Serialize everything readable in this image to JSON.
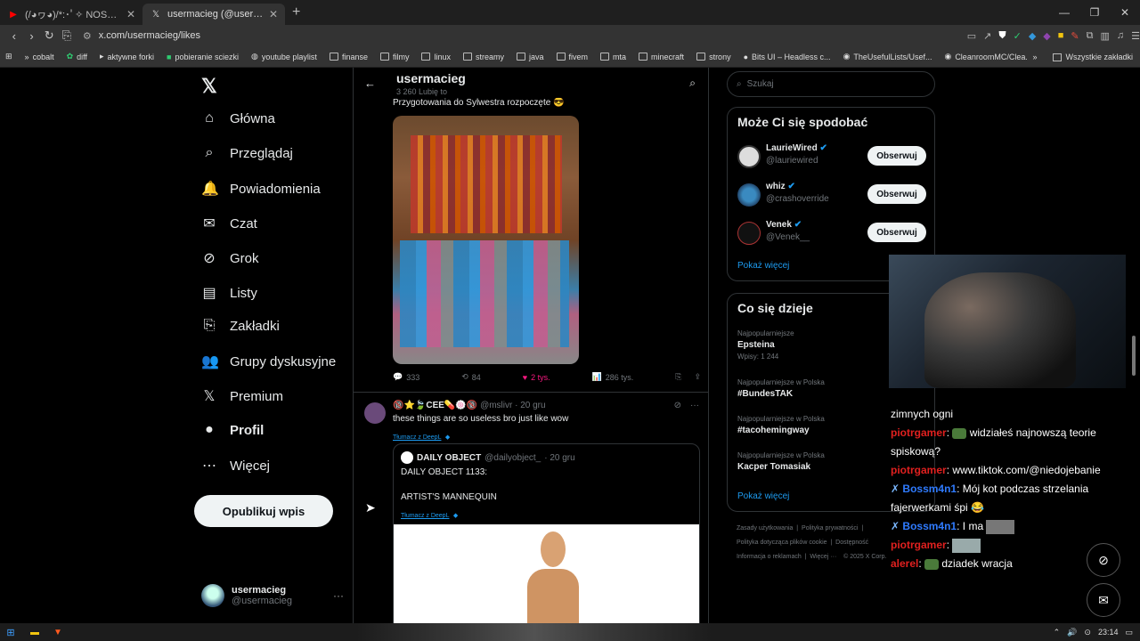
{
  "browser": {
    "tabs": [
      {
        "title": "(/◕ヮ◕)/*:･ﾟ✧ NOSTALGIC HEXD",
        "active": false
      },
      {
        "title": "usermacieg (@usermacieg) / X",
        "active": true
      }
    ],
    "new_tab": "+",
    "url": "x.com/usermacieg/likes",
    "bookmarks": [
      "cobalt",
      "diff",
      "aktywne forki",
      "pobieranie sciezki",
      "youtube playlist",
      "finanse",
      "filmy",
      "linux",
      "streamy",
      "java",
      "fivem",
      "mta",
      "minecraft",
      "strony",
      "Bits UI – Headless c...",
      "TheUsefulLists/Usef...",
      "CleanroomMC/Clea..."
    ],
    "bookmarks_overflow": "»",
    "all_bookmarks": "Wszystkie zakładki"
  },
  "nav": {
    "items": [
      {
        "label": "Główna",
        "icon": "home-icon",
        "glyph": "⌂"
      },
      {
        "label": "Przeglądaj",
        "icon": "search-icon",
        "glyph": "⌕"
      },
      {
        "label": "Powiadomienia",
        "icon": "bell-icon",
        "glyph": "🔔"
      },
      {
        "label": "Czat",
        "icon": "mail-icon",
        "glyph": "✉"
      },
      {
        "label": "Grok",
        "icon": "grok-icon",
        "glyph": "⊘"
      },
      {
        "label": "Listy",
        "icon": "list-icon",
        "glyph": "▤"
      },
      {
        "label": "Zakładki",
        "icon": "bookmark-icon",
        "glyph": "⎘"
      },
      {
        "label": "Grupy dyskusyjne",
        "icon": "people-icon",
        "glyph": "👥"
      },
      {
        "label": "Premium",
        "icon": "x-logo-icon",
        "glyph": "𝕏"
      },
      {
        "label": "Profil",
        "icon": "person-icon",
        "glyph": "●"
      },
      {
        "label": "Więcej",
        "icon": "more-circle-icon",
        "glyph": "⋯"
      }
    ],
    "post_button": "Opublikuj wpis",
    "account": {
      "name": "usermacieg",
      "handle": "@usermacieg"
    }
  },
  "header": {
    "name": "usermacieg",
    "subtitle": "3 260 Lubię to"
  },
  "tweet1": {
    "text": "Przygotowania do Sylwestra rozpoczęte 😎",
    "replies": "333",
    "reposts": "84",
    "likes": "2 tys.",
    "views": "286 tys."
  },
  "tweet2": {
    "name": "🔞⭐🍃CEE💊🍥🔞",
    "handle": "@mslivr",
    "date": "· 20 gru",
    "text": "these things are so useless bro just like wow",
    "translate": "Tłumacz z DeepL",
    "quote": {
      "name": "DAILY OBJECT",
      "handle": "@dailyobject_",
      "date": "· 20 gru",
      "line1": "DAILY OBJECT 1133:",
      "line2": "ARTIST'S MANNEQUIN",
      "translate": "Tłumacz z DeepL"
    }
  },
  "sidebar": {
    "search_placeholder": "Szukaj",
    "who_to_follow": {
      "title": "Może Ci się spodobać",
      "users": [
        {
          "name": "LaurieWired",
          "handle": "@lauriewired",
          "button": "Obserwuj"
        },
        {
          "name": "whiz",
          "handle": "@crashoverride",
          "button": "Obserwuj"
        },
        {
          "name": "Venek",
          "handle": "@Venek__",
          "button": "Obserwuj"
        }
      ],
      "more": "Pokaż więcej"
    },
    "trends": {
      "title": "Co się dzieje",
      "items": [
        {
          "context": "Najpopularniejsze",
          "topic": "Epsteina",
          "count": "Wpisy: 1 244"
        },
        {
          "context": "Najpopularniejsze w Polska",
          "topic": "#BundesTAK",
          "count": ""
        },
        {
          "context": "Najpopularniejsze w Polska",
          "topic": "#tacohemingway",
          "count": ""
        },
        {
          "context": "Najpopularniejsze w Polska",
          "topic": "Kacper Tomasiak",
          "count": ""
        }
      ],
      "more": "Pokaż więcej"
    },
    "footer": {
      "l1a": "Zasady użytkowania",
      "l1b": "Polityka prywatności",
      "l2a": "Polityka dotycząca plików cookie",
      "l2b": "Dostępność",
      "l3a": "Informacja o reklamach",
      "l3b": "Więcej ···",
      "l3c": "© 2025 X Corp."
    }
  },
  "chat": {
    "lines": [
      {
        "user": "",
        "text": "zimnych ogni"
      },
      {
        "user": "piotrgamer",
        "text": "widziałeś najnowszą teorie spiskową?"
      },
      {
        "user": "piotrgamer",
        "text": "www.tiktok.com/@niedojebanie"
      },
      {
        "user": "Bossm4n1",
        "text": "Mój kot podczas strzelania fajerwerkami śpi 😂"
      },
      {
        "user": "Bossm4n1",
        "text": "I ma"
      },
      {
        "user": "piotrgamer",
        "text": ""
      },
      {
        "user": "alerel",
        "text": "dziadek wracja"
      }
    ]
  },
  "taskbar": {
    "time": "23:14"
  }
}
